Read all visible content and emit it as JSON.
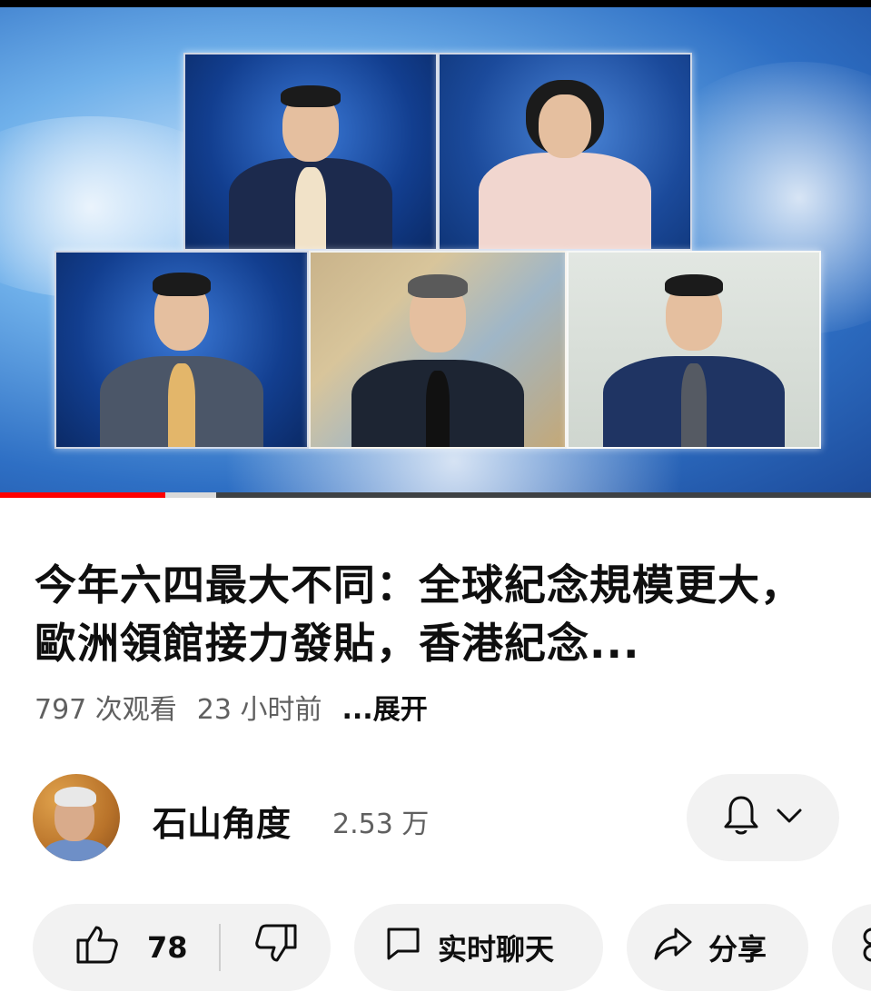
{
  "video": {
    "progress_played": 0.19,
    "progress_buffered": 0.248
  },
  "title": "今年六四最大不同：全球紀念規模更大，歐洲領館接力發貼，香港紀念...",
  "meta": {
    "views": "797 次观看",
    "age": "23 小时前",
    "more": "...展开"
  },
  "channel": {
    "name": "石山角度",
    "subscribers": "2.53 万"
  },
  "actions": {
    "like_count": "78",
    "live_chat": "实时聊天",
    "share": "分享"
  },
  "icons": [
    "thumbs-up-icon",
    "thumbs-down-icon",
    "chat-icon",
    "share-icon",
    "bell-icon",
    "chevron-down-icon"
  ],
  "colors": {
    "progress_red": "#ff0000",
    "pill_bg": "#f2f2f2",
    "secondary_text": "#606060"
  }
}
